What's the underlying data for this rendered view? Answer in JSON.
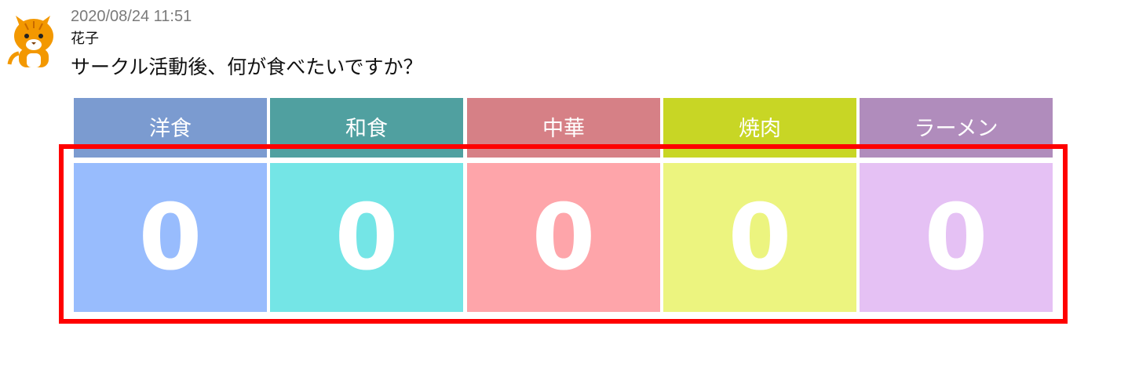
{
  "post": {
    "timestamp": "2020/08/24 11:51",
    "author": "花子",
    "message": "サークル活動後、何が食べたいですか？",
    "avatar_icon": "cat-avatar-icon"
  },
  "options": [
    {
      "label": "洋食",
      "count": "0",
      "header_color": "#7b9bd0",
      "body_color": "#98bcfd"
    },
    {
      "label": "和食",
      "count": "0",
      "header_color": "#50a0a0",
      "body_color": "#74e5e6"
    },
    {
      "label": "中華",
      "count": "0",
      "header_color": "#d68086",
      "body_color": "#fea5aa"
    },
    {
      "label": "焼肉",
      "count": "0",
      "header_color": "#c8d625",
      "body_color": "#ecf47f"
    },
    {
      "label": "ラーメン",
      "count": "0",
      "header_color": "#b08cbc",
      "body_color": "#e5c1f4"
    }
  ],
  "highlight_color": "#ff0000"
}
